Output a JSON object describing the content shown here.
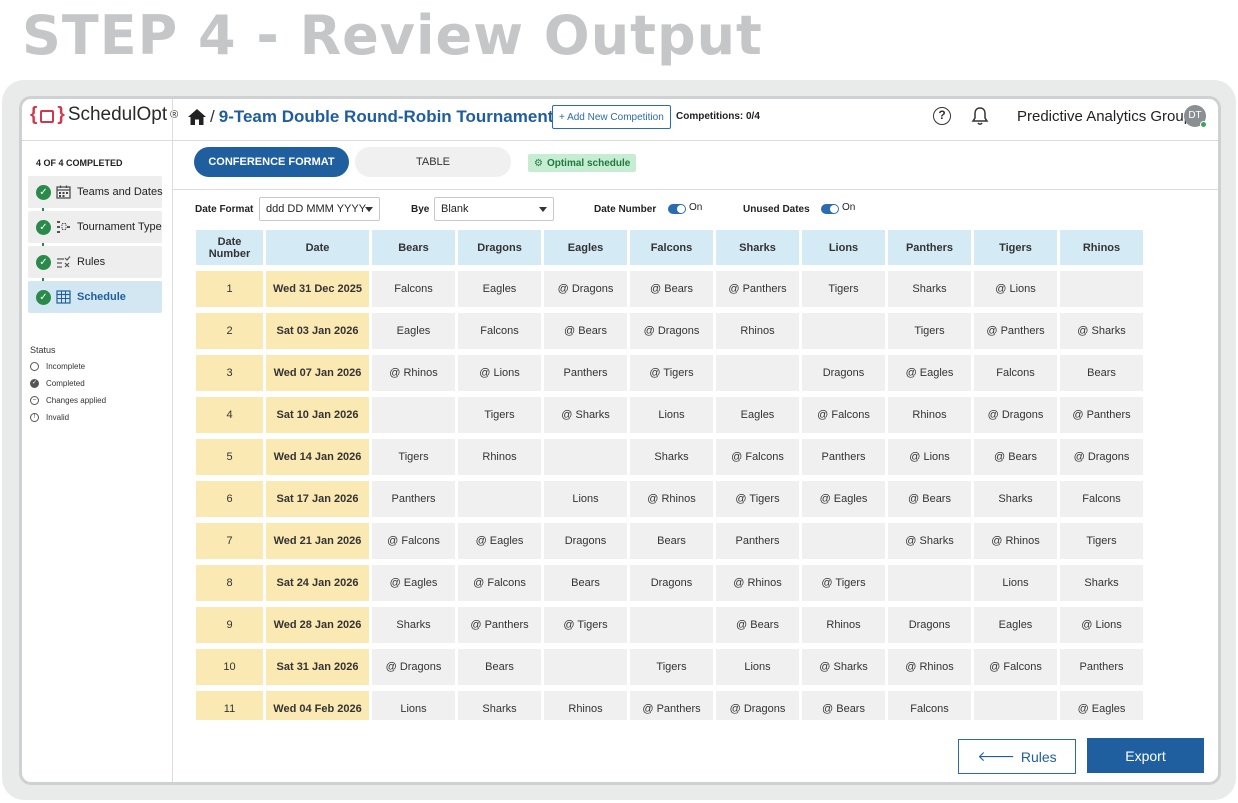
{
  "step_heading": "STEP 4 - Review Output",
  "app": {
    "logo": "SchedulOpt",
    "logo_mark": "®"
  },
  "header": {
    "breadcrumb_sep": "/",
    "title": "9-Team Double Round-Robin Tournament",
    "add_button": "+ Add New Competition",
    "competitions": "Competitions: 0/4",
    "org": "Predictive Analytics Group",
    "avatar": "DT"
  },
  "sidebar": {
    "completed": "4 OF 4 COMPLETED",
    "steps": [
      {
        "label": "Teams and Dates",
        "icon": "calendar-icon"
      },
      {
        "label": "Tournament Type",
        "icon": "bracket-icon"
      },
      {
        "label": "Rules",
        "icon": "rules-icon"
      },
      {
        "label": "Schedule",
        "icon": "table-icon"
      }
    ],
    "status_title": "Status",
    "status": [
      "Incomplete",
      "Completed",
      "Changes applied",
      "Invalid"
    ]
  },
  "tabs": {
    "active": "CONFERENCE FORMAT",
    "inactive": "TABLE"
  },
  "badge": "Optimal schedule",
  "options": {
    "date_format_label": "Date Format",
    "date_format_value": "ddd DD MMM YYYY",
    "bye_label": "Bye",
    "bye_value": "Blank",
    "date_number_label": "Date Number",
    "date_number_state": "On",
    "unused_dates_label": "Unused Dates",
    "unused_dates_state": "On"
  },
  "table": {
    "headers": [
      "Date Number",
      "Date",
      "Bears",
      "Dragons",
      "Eagles",
      "Falcons",
      "Sharks",
      "Lions",
      "Panthers",
      "Tigers",
      "Rhinos"
    ],
    "rows": [
      [
        "1",
        "Wed 31 Dec 2025",
        "Falcons",
        "Eagles",
        "@ Dragons",
        "@ Bears",
        "@ Panthers",
        "Tigers",
        "Sharks",
        "@ Lions",
        ""
      ],
      [
        "2",
        "Sat 03 Jan 2026",
        "Eagles",
        "Falcons",
        "@ Bears",
        "@ Dragons",
        "Rhinos",
        "",
        "Tigers",
        "@ Panthers",
        "@ Sharks"
      ],
      [
        "3",
        "Wed 07 Jan 2026",
        "@ Rhinos",
        "@ Lions",
        "Panthers",
        "@ Tigers",
        "",
        "Dragons",
        "@ Eagles",
        "Falcons",
        "Bears"
      ],
      [
        "4",
        "Sat 10 Jan 2026",
        "",
        "Tigers",
        "@ Sharks",
        "Lions",
        "Eagles",
        "@ Falcons",
        "Rhinos",
        "@ Dragons",
        "@ Panthers"
      ],
      [
        "5",
        "Wed 14 Jan 2026",
        "Tigers",
        "Rhinos",
        "",
        "Sharks",
        "@ Falcons",
        "Panthers",
        "@ Lions",
        "@ Bears",
        "@ Dragons"
      ],
      [
        "6",
        "Sat 17 Jan 2026",
        "Panthers",
        "",
        "Lions",
        "@ Rhinos",
        "@ Tigers",
        "@ Eagles",
        "@ Bears",
        "Sharks",
        "Falcons"
      ],
      [
        "7",
        "Wed 21 Jan 2026",
        "@ Falcons",
        "@ Eagles",
        "Dragons",
        "Bears",
        "Panthers",
        "",
        "@ Sharks",
        "@ Rhinos",
        "Tigers"
      ],
      [
        "8",
        "Sat 24 Jan 2026",
        "@ Eagles",
        "@ Falcons",
        "Bears",
        "Dragons",
        "@ Rhinos",
        "@ Tigers",
        "",
        "Lions",
        "Sharks"
      ],
      [
        "9",
        "Wed 28 Jan 2026",
        "Sharks",
        "@ Panthers",
        "@ Tigers",
        "",
        "@ Bears",
        "Rhinos",
        "Dragons",
        "Eagles",
        "@ Lions"
      ],
      [
        "10",
        "Sat 31 Jan 2026",
        "@ Dragons",
        "Bears",
        "",
        "Tigers",
        "Lions",
        "@ Sharks",
        "@ Rhinos",
        "@ Falcons",
        "Panthers"
      ],
      [
        "11",
        "Wed 04 Feb 2026",
        "Lions",
        "Sharks",
        "Rhinos",
        "@ Panthers",
        "@ Dragons",
        "@ Bears",
        "Falcons",
        "",
        "@ Eagles"
      ]
    ]
  },
  "footer": {
    "rules": "Rules",
    "export": "Export"
  },
  "colors": {
    "primary": "#1f5f9f",
    "date_cell": "#fbe9b4",
    "header_cell": "#d4eaf5",
    "cell": "#f0f0f0",
    "success": "#2a8a4a"
  }
}
